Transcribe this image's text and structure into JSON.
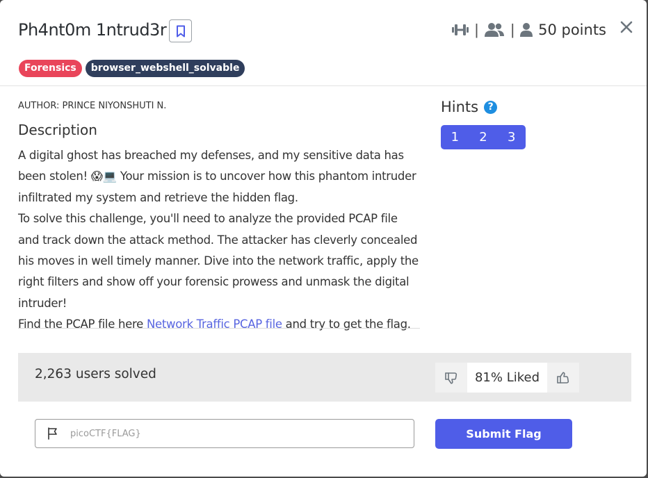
{
  "challenge": {
    "title": "Ph4nt0m 1ntrud3r",
    "points_text": "50 points",
    "tags": [
      {
        "label": "Forensics",
        "color": "#e9455a"
      },
      {
        "label": "browser_webshell_solvable",
        "color": "#2f3e5c"
      }
    ]
  },
  "meta_icons": [
    "dumbbell-icon",
    "users-icon",
    "user-icon"
  ],
  "meta_separator": "|",
  "author": "AUTHOR: PRINCE NIYONSHUTI N.",
  "description": {
    "heading": "Description",
    "para1": "A digital ghost has breached my defenses, and my sensitive data has been stolen! 😱💻 Your mission is to uncover how this phantom intruder infiltrated my system and retrieve the hidden flag.",
    "para2": "To solve this challenge, you'll need to analyze the provided PCAP file and track down the attack method. The attacker has cleverly concealed his moves in well timely manner. Dive into the network traffic, apply the right filters and show off your forensic prowess and unmask the digital intruder!",
    "para3_prefix": "Find the PCAP file here ",
    "para3_link": "Network Traffic PCAP file",
    "para3_suffix": " and try to get the flag."
  },
  "hints": {
    "title": "Hints",
    "help_glyph": "?",
    "buttons": [
      "1",
      "2",
      "3"
    ]
  },
  "stats": {
    "solved_text": "2,263 users solved",
    "liked_text": "81% Liked"
  },
  "flag_form": {
    "placeholder": "picoCTF{FLAG}",
    "value": "",
    "submit_label": "Submit Flag"
  },
  "colors": {
    "accent": "#4f5de8",
    "forensics_tag": "#e9455a",
    "dark_tag": "#2f3e5c",
    "link": "#5865e0"
  }
}
